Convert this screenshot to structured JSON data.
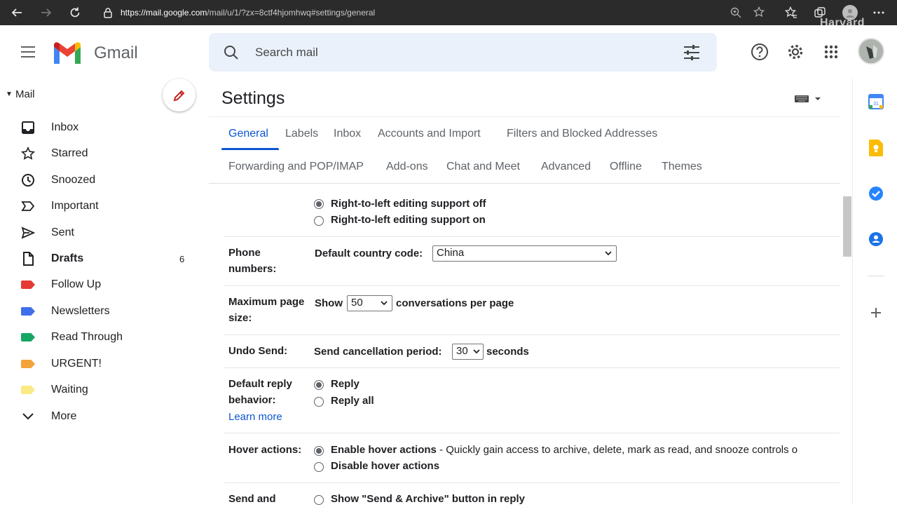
{
  "browser": {
    "url_host": "https://mail.google.com",
    "url_path": "/mail/u/1/?zx=8ctf4hjomhwq#settings/general",
    "watermark": "Harvard"
  },
  "header": {
    "app_name": "Gmail",
    "search_placeholder": "Search mail"
  },
  "sidebar": {
    "section": "Mail",
    "items": [
      {
        "label": "Inbox",
        "icon": "inbox-icon"
      },
      {
        "label": "Starred",
        "icon": "star-icon"
      },
      {
        "label": "Snoozed",
        "icon": "clock-icon"
      },
      {
        "label": "Important",
        "icon": "important-icon"
      },
      {
        "label": "Sent",
        "icon": "send-icon"
      },
      {
        "label": "Drafts",
        "icon": "draft-icon",
        "count": "6"
      },
      {
        "label": "Follow Up",
        "icon": "label-icon",
        "color": "#e53935"
      },
      {
        "label": "Newsletters",
        "icon": "label-icon",
        "color": "#3f6ee8"
      },
      {
        "label": "Read Through",
        "icon": "label-icon",
        "color": "#16a765"
      },
      {
        "label": "URGENT!",
        "icon": "label-icon",
        "color": "#f2a33a"
      },
      {
        "label": "Waiting",
        "icon": "label-icon",
        "color": "#fbe983"
      },
      {
        "label": "More",
        "icon": "chevron-down-icon"
      }
    ]
  },
  "settings": {
    "title": "Settings",
    "tabs_row1": [
      "General",
      "Labels",
      "Inbox",
      "Accounts and Import",
      "Filters and Blocked Addresses"
    ],
    "tabs_row2": [
      "Forwarding and POP/IMAP",
      "Add-ons",
      "Chat and Meet",
      "Advanced",
      "Offline",
      "Themes"
    ],
    "rtl": {
      "off": "Right-to-left editing support off",
      "on": "Right-to-left editing support on"
    },
    "phone": {
      "label_line1": "Phone",
      "label_line2": "numbers:",
      "text": "Default country code:",
      "value": "China"
    },
    "page_size": {
      "label_line1": "Maximum page",
      "label_line2": "size:",
      "prefix": "Show",
      "value": "50",
      "suffix": "conversations per page"
    },
    "undo": {
      "label": "Undo Send:",
      "text": "Send cancellation period:",
      "value": "30",
      "suffix": "seconds"
    },
    "reply": {
      "label_line1": "Default reply",
      "label_line2": "behavior:",
      "link": "Learn more",
      "opt1": "Reply",
      "opt2": "Reply all"
    },
    "hover": {
      "label": "Hover actions:",
      "opt1": "Enable hover actions",
      "opt1_desc": " - Quickly gain access to archive, delete, mark as read, and snooze controls o",
      "opt2": "Disable hover actions"
    },
    "send_archive": {
      "label": "Send and",
      "opt1": "Show \"Send & Archive\" button in reply"
    }
  }
}
